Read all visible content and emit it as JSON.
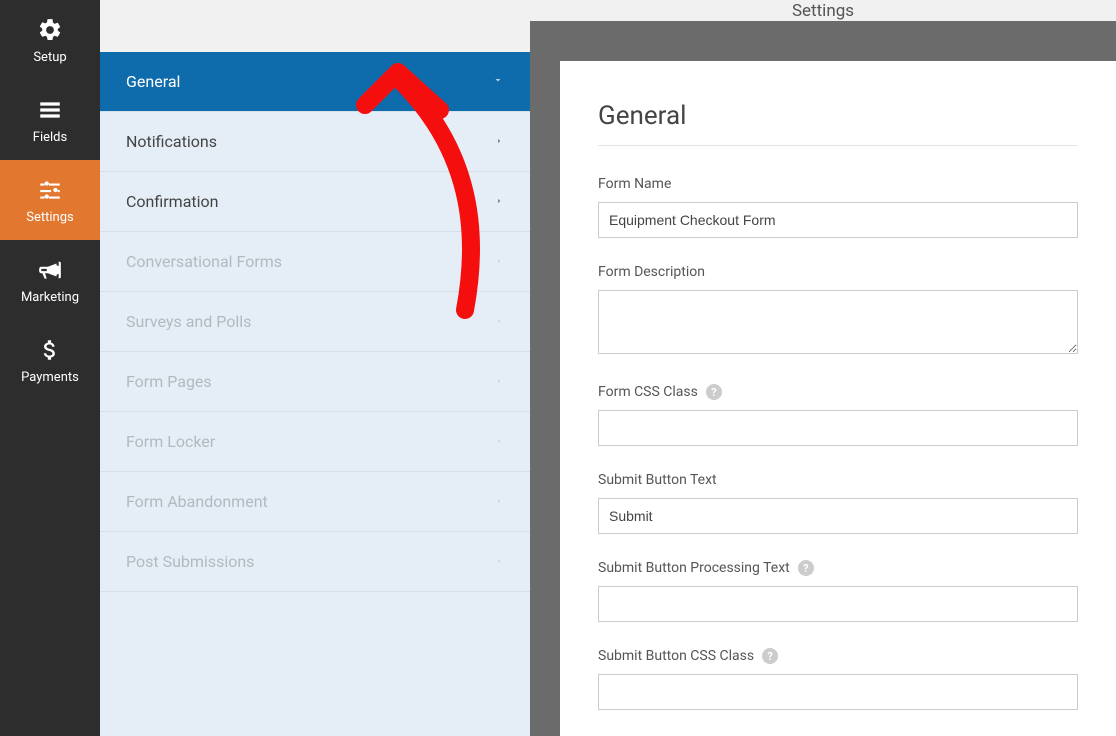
{
  "header": {
    "title": "Settings"
  },
  "nav": [
    {
      "id": "setup",
      "label": "Setup",
      "icon": "gear"
    },
    {
      "id": "fields",
      "label": "Fields",
      "icon": "list"
    },
    {
      "id": "settings",
      "label": "Settings",
      "icon": "sliders",
      "active": true
    },
    {
      "id": "marketing",
      "label": "Marketing",
      "icon": "bullhorn"
    },
    {
      "id": "payments",
      "label": "Payments",
      "icon": "dollar"
    }
  ],
  "settings_list": [
    {
      "label": "General",
      "active": true,
      "chevron": "down"
    },
    {
      "label": "Notifications",
      "chevron": "right"
    },
    {
      "label": "Confirmation",
      "chevron": "right"
    },
    {
      "label": "Conversational Forms",
      "chevron": "right",
      "muted": true
    },
    {
      "label": "Surveys and Polls",
      "chevron": "right",
      "muted": true
    },
    {
      "label": "Form Pages",
      "chevron": "right",
      "muted": true
    },
    {
      "label": "Form Locker",
      "chevron": "right",
      "muted": true
    },
    {
      "label": "Form Abandonment",
      "chevron": "right",
      "muted": true
    },
    {
      "label": "Post Submissions",
      "chevron": "right",
      "muted": true
    }
  ],
  "panel": {
    "title": "General",
    "fields": {
      "form_name": {
        "label": "Form Name",
        "value": "Equipment Checkout Form"
      },
      "form_description": {
        "label": "Form Description",
        "value": ""
      },
      "form_css_class": {
        "label": "Form CSS Class",
        "value": "",
        "help": true
      },
      "submit_button_text": {
        "label": "Submit Button Text",
        "value": "Submit"
      },
      "submit_button_processing_text": {
        "label": "Submit Button Processing Text",
        "value": "",
        "help": true
      },
      "submit_button_css_class": {
        "label": "Submit Button CSS Class",
        "value": "",
        "help": true
      }
    }
  },
  "annotation": {
    "color": "#f40e0e"
  }
}
